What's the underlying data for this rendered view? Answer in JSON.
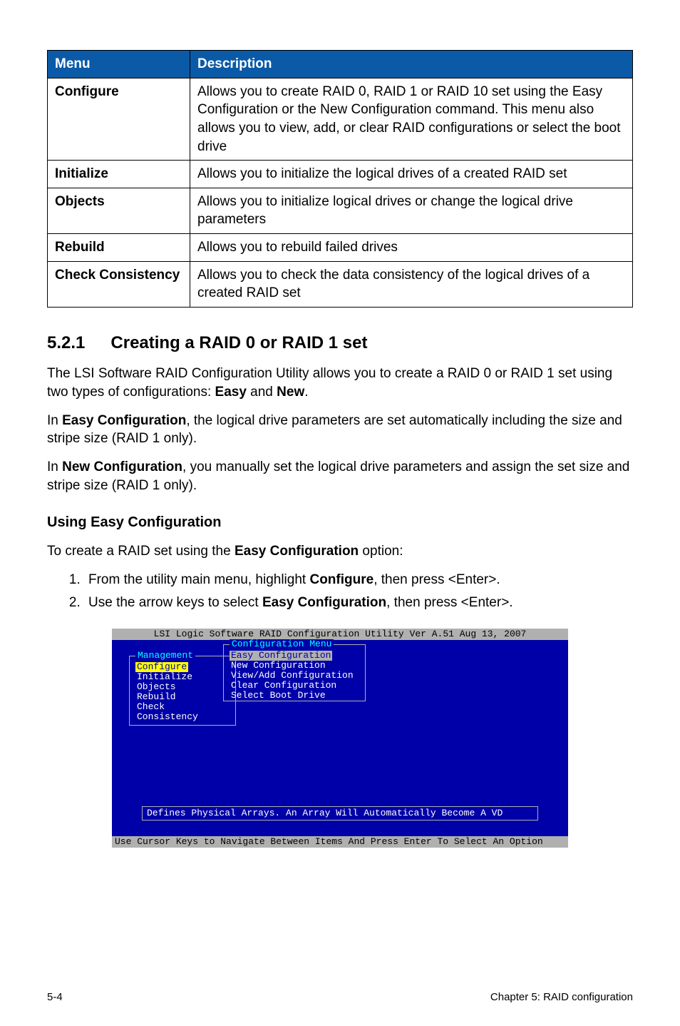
{
  "table": {
    "headers": {
      "menu": "Menu",
      "description": "Description"
    },
    "rows": [
      {
        "menu": "Configure",
        "desc": "Allows you to create RAID 0, RAID 1 or RAID 10 set using the Easy Configuration or the New Configuration command. This menu also allows you to view, add, or clear RAID configurations or select the boot drive"
      },
      {
        "menu": "Initialize",
        "desc": "Allows you to initialize the logical drives of a created RAID set"
      },
      {
        "menu": "Objects",
        "desc": "Allows you to initialize logical drives or change the logical drive parameters"
      },
      {
        "menu": "Rebuild",
        "desc": "Allows you to rebuild failed drives"
      },
      {
        "menu": "Check Consistency",
        "desc": "Allows you to check the data consistency of the logical drives of a created RAID set"
      }
    ]
  },
  "section": {
    "number": "5.2.1",
    "title": "Creating a RAID 0 or RAID 1 set",
    "para1_a": "The LSI Software RAID Configuration Utility allows you to create a RAID 0 or RAID 1 set using two types of configurations: ",
    "para1_b": "Easy",
    "para1_c": " and ",
    "para1_d": "New",
    "para1_e": ".",
    "para2_a": "In ",
    "para2_b": "Easy Configuration",
    "para2_c": ", the logical drive parameters are set automatically including the size and stripe size (RAID 1 only).",
    "para3_a": "In ",
    "para3_b": "New Configuration",
    "para3_c": ", you manually set the logical drive parameters and assign the set size and stripe size (RAID 1 only).",
    "sub_title": "Using Easy Configuration",
    "sub_intro_a": "To create a RAID set using the ",
    "sub_intro_b": "Easy Configuration",
    "sub_intro_c": " option:",
    "steps": [
      {
        "a": "From the utility main menu, highlight ",
        "b": "Configure",
        "c": ", then press <Enter>."
      },
      {
        "a": "Use the arrow keys to select ",
        "b": "Easy Configuration",
        "c": ", then press <Enter>."
      }
    ]
  },
  "bios": {
    "title": "LSI Logic Software RAID Configuration Utility Ver A.51 Aug 13, 2007",
    "mgmt_label": "Management",
    "mgmt_items": [
      "Configure",
      "Initialize",
      "Objects",
      "Rebuild",
      "Check Consistency"
    ],
    "cfg_label": "Configuration Menu",
    "cfg_items": [
      "Easy Configuration",
      "New Configuration",
      "View/Add Configuration",
      "Clear Configuration",
      "Select Boot Drive"
    ],
    "hint": "Defines Physical Arrays. An Array Will Automatically Become A VD",
    "footer": "Use Cursor Keys to Navigate Between Items And Press Enter To Select An Option"
  },
  "footer": {
    "left": "5-4",
    "right": "Chapter 5: RAID configuration"
  }
}
